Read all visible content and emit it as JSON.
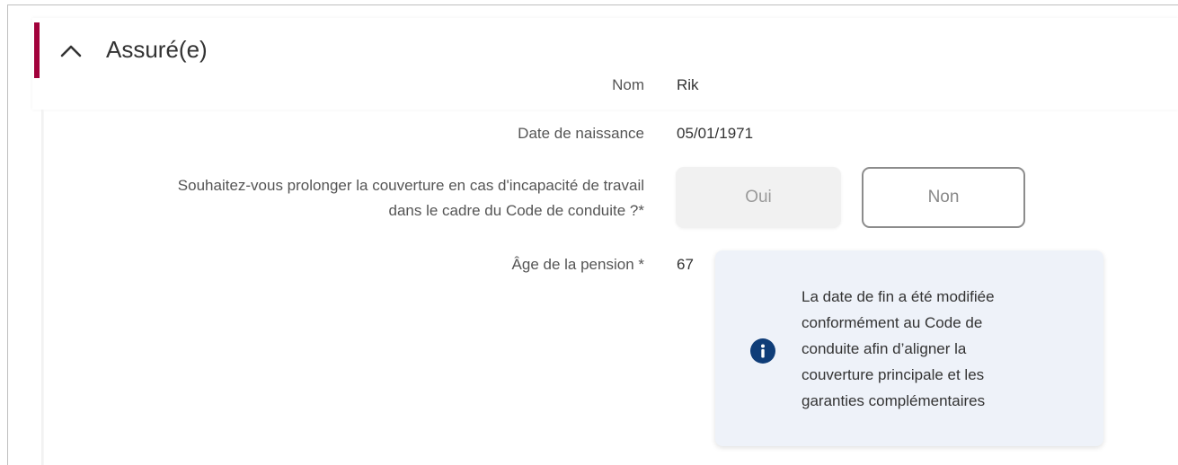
{
  "section": {
    "title": "Assuré(e)",
    "toggle_icon": "chevron-up-icon"
  },
  "fields": {
    "nom": {
      "label": "Nom",
      "value": "Rik"
    },
    "date_naissance": {
      "label": "Date de naissance",
      "value": "05/01/1971"
    },
    "prolonger": {
      "label_line1": "Souhaitez-vous prolonger la couverture en cas d'incapacité de travail",
      "label_line2": "dans le cadre du Code de conduite ?*",
      "options": {
        "oui": "Oui",
        "non": "Non"
      }
    },
    "age_pension": {
      "label": "Âge de la pension *",
      "value": "67"
    }
  },
  "info": {
    "icon": "info-icon",
    "lines": [
      "La date de fin a été modifiée",
      "conformément au Code de",
      "conduite afin d’aligner la",
      "couverture principale et les",
      "garanties complémentaires"
    ]
  },
  "colors": {
    "accent": "#a1003a",
    "info_bg": "#eef2f9",
    "info_icon": "#0f3d78"
  }
}
